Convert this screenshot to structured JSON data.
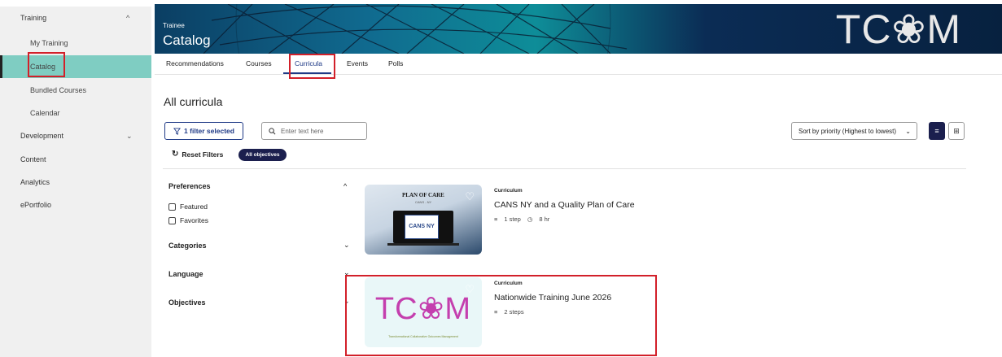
{
  "sidebar": {
    "training": "Training",
    "my_training": "My Training",
    "catalog": "Catalog",
    "bundled_courses": "Bundled Courses",
    "calendar": "Calendar",
    "development": "Development",
    "content": "Content",
    "analytics": "Analytics",
    "eportfolio": "ePortfolio"
  },
  "banner": {
    "subtitle": "Trainee",
    "title": "Catalog",
    "logo": "TC❀M"
  },
  "tabs": [
    "Recommendations",
    "Courses",
    "Curricula",
    "Events",
    "Polls"
  ],
  "page_title": "All curricula",
  "toolbar": {
    "filter_label": "1 filter selected",
    "search_placeholder": "Enter text here",
    "sort_label": "Sort by priority (Highest to lowest)",
    "reset_label": "Reset Filters",
    "pill_label": "All objectives"
  },
  "facets": {
    "preferences": "Preferences",
    "featured": "Featured",
    "favorites": "Favorites",
    "categories": "Categories",
    "language": "Language",
    "objectives": "Objectives"
  },
  "cards": [
    {
      "type_label": "Curriculum",
      "title": "CANS NY and a Quality Plan of Care",
      "steps": "1 step",
      "duration": "8 hr",
      "thumb_text": "PLAN OF CARE",
      "thumb_sub": "CANS - NY",
      "thumb_logo": "CANS NY"
    },
    {
      "type_label": "Curriculum",
      "title": "Nationwide Training June 2026",
      "steps": "2 steps",
      "thumb_logo": "TC❀M",
      "thumb_sub": "Transformational Collaborative Outcomes Management"
    }
  ],
  "colors": {
    "accent": "#1f3a86",
    "sidebar_active": "#7fcdc2",
    "highlight": "#d2202a",
    "pill": "#1b1f4e"
  }
}
